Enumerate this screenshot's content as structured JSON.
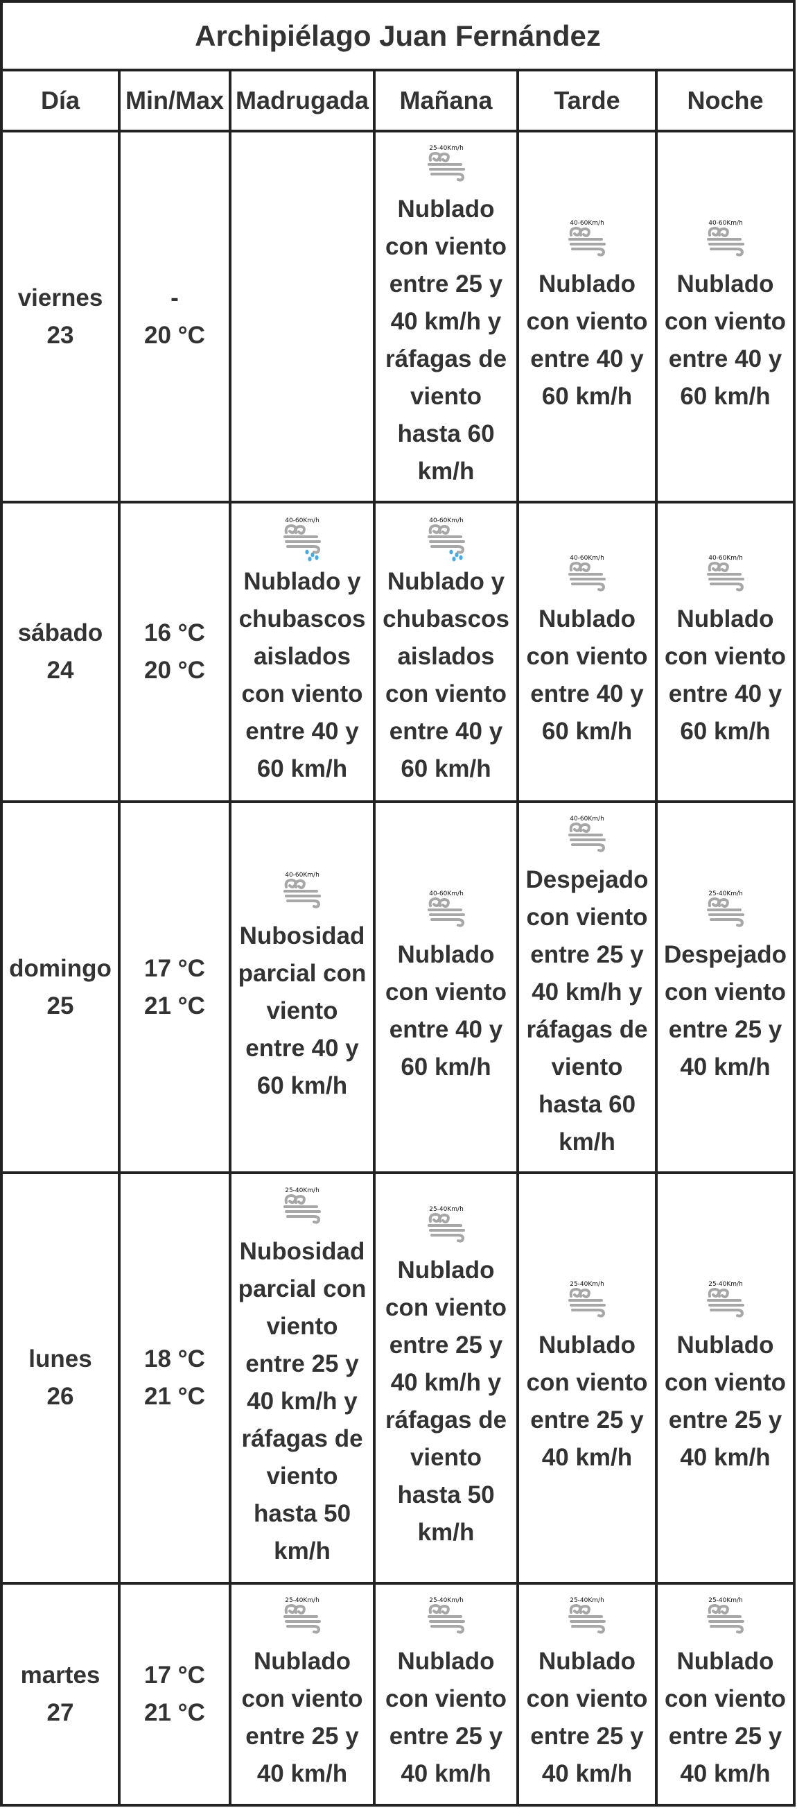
{
  "title": "Archipiélago Juan Fernández",
  "headers": [
    "Día",
    "Min/Max",
    "Madrugada",
    "Mañana",
    "Tarde",
    "Noche"
  ],
  "rows": [
    {
      "day": "viernes",
      "date": "23",
      "min": "-",
      "max": "20 °C",
      "periods": [
        null,
        {
          "icon": "wind-icon",
          "wind": "25-40Km/h",
          "text": "Nublado con viento entre 25 y 40 km/h y ráfagas de viento hasta 60 km/h"
        },
        {
          "icon": "wind-icon",
          "wind": "40-60Km/h",
          "text": "Nublado con viento entre 40 y 60 km/h"
        },
        {
          "icon": "wind-icon",
          "wind": "40-60Km/h",
          "text": "Nublado con viento entre 40 y 60 km/h"
        }
      ]
    },
    {
      "day": "sábado",
      "date": "24",
      "min": "16 °C",
      "max": "20 °C",
      "periods": [
        {
          "icon": "wind-rain-icon",
          "wind": "40-60Km/h",
          "text": "Nublado y chubascos aislados con viento entre 40 y 60 km/h"
        },
        {
          "icon": "wind-rain-icon",
          "wind": "40-60Km/h",
          "text": "Nublado y chubascos aislados con viento entre 40 y 60 km/h"
        },
        {
          "icon": "wind-icon",
          "wind": "40-60Km/h",
          "text": "Nublado con viento entre 40 y 60 km/h"
        },
        {
          "icon": "wind-icon",
          "wind": "40-60Km/h",
          "text": "Nublado con viento entre 40 y 60 km/h"
        }
      ]
    },
    {
      "day": "domingo",
      "date": "25",
      "min": "17 °C",
      "max": "21 °C",
      "periods": [
        {
          "icon": "wind-icon",
          "wind": "40-60Km/h",
          "text": "Nubosidad parcial con viento entre 40 y 60 km/h"
        },
        {
          "icon": "wind-icon",
          "wind": "40-60Km/h",
          "text": "Nublado con viento entre 40 y 60 km/h"
        },
        {
          "icon": "wind-icon",
          "wind": "40-60Km/h",
          "text": "Despejado con viento entre 25 y 40 km/h y ráfagas de viento hasta 60 km/h"
        },
        {
          "icon": "wind-icon",
          "wind": "25-40Km/h",
          "text": "Despejado con viento entre 25 y 40 km/h"
        }
      ]
    },
    {
      "day": "lunes",
      "date": "26",
      "min": "18 °C",
      "max": "21 °C",
      "periods": [
        {
          "icon": "wind-icon",
          "wind": "25-40Km/h",
          "text": "Nubosidad parcial con viento entre 25 y 40 km/h y ráfagas de viento hasta 50 km/h"
        },
        {
          "icon": "wind-icon",
          "wind": "25-40Km/h",
          "text": "Nublado con viento entre 25 y 40 km/h y ráfagas de viento hasta 50 km/h"
        },
        {
          "icon": "wind-icon",
          "wind": "25-40Km/h",
          "text": "Nublado con viento entre 25 y 40 km/h"
        },
        {
          "icon": "wind-icon",
          "wind": "25-40Km/h",
          "text": "Nublado con viento entre 25 y 40 km/h"
        }
      ]
    },
    {
      "day": "martes",
      "date": "27",
      "min": "17 °C",
      "max": "21 °C",
      "periods": [
        {
          "icon": "wind-icon",
          "wind": "25-40Km/h",
          "text": "Nublado con viento entre 25 y 40 km/h"
        },
        {
          "icon": "wind-icon",
          "wind": "25-40Km/h",
          "text": "Nublado con viento entre 25 y 40 km/h"
        },
        {
          "icon": "wind-icon",
          "wind": "25-40Km/h",
          "text": "Nublado con viento entre 25 y 40 km/h"
        },
        {
          "icon": "wind-icon",
          "wind": "25-40Km/h",
          "text": "Nublado con viento entre 25 y 40 km/h"
        }
      ]
    }
  ]
}
